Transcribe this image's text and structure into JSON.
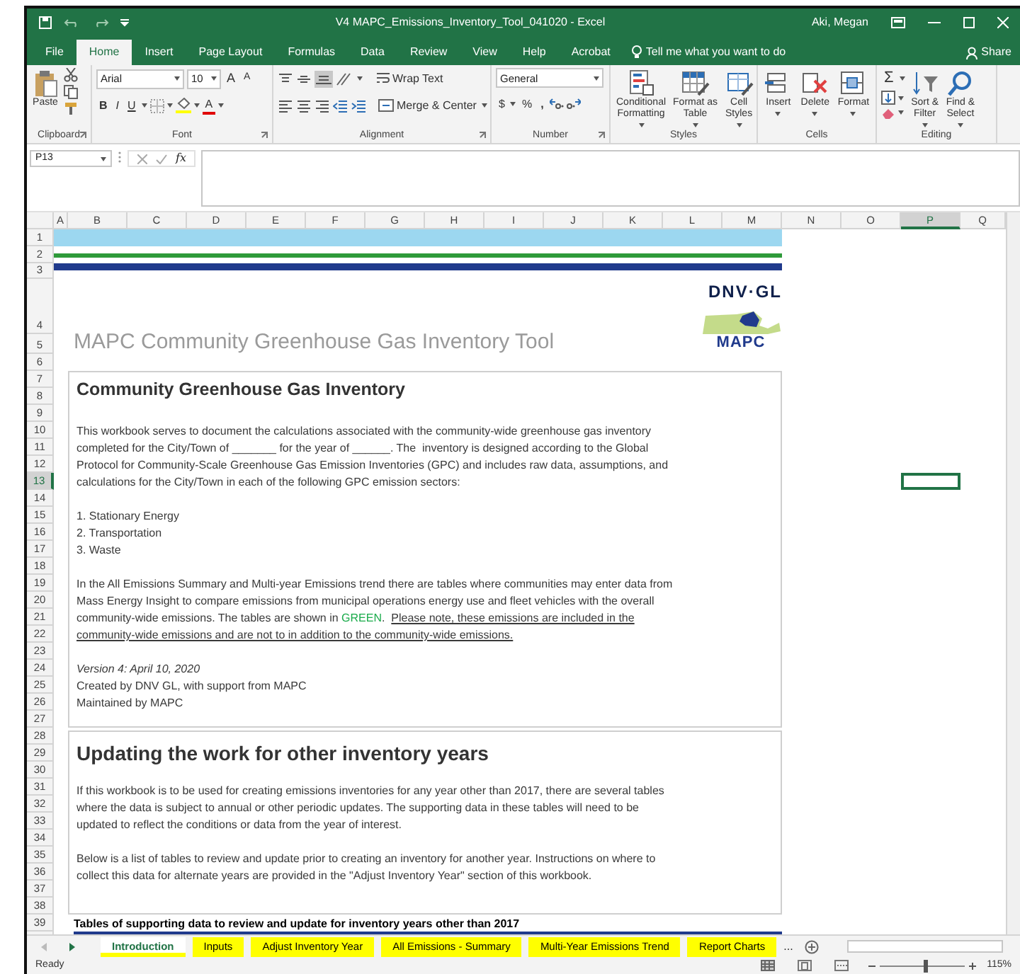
{
  "window": {
    "title": "V4 MAPC_Emissions_Inventory_Tool_041020  -  Excel",
    "user": "Aki, Megan"
  },
  "ribbon_tabs": [
    {
      "label": "File",
      "selected": false
    },
    {
      "label": "Home",
      "selected": true
    },
    {
      "label": "Insert",
      "selected": false
    },
    {
      "label": "Page Layout",
      "selected": false
    },
    {
      "label": "Formulas",
      "selected": false
    },
    {
      "label": "Data",
      "selected": false
    },
    {
      "label": "Review",
      "selected": false
    },
    {
      "label": "View",
      "selected": false
    },
    {
      "label": "Help",
      "selected": false
    },
    {
      "label": "Acrobat",
      "selected": false
    }
  ],
  "tell_me": "Tell me what you want to do",
  "share": "Share",
  "ribbon": {
    "clipboard": {
      "label": "Clipboard",
      "paste": "Paste"
    },
    "font": {
      "label": "Font",
      "font_name": "Arial",
      "font_size": "10",
      "grow": "A",
      "shrink": "A",
      "bold": "B",
      "italic": "I",
      "underline": "U",
      "font_color": "A"
    },
    "alignment": {
      "label": "Alignment",
      "wrap_text": "Wrap Text",
      "merge_center": "Merge & Center"
    },
    "number": {
      "label": "Number",
      "format": "General",
      "currency": "$",
      "percent": "%",
      "comma": ","
    },
    "styles": {
      "label": "Styles",
      "buttons": [
        {
          "lines": [
            "Conditional",
            "Formatting"
          ]
        },
        {
          "lines": [
            "Format as",
            "Table"
          ]
        },
        {
          "lines": [
            "Cell",
            "Styles"
          ]
        }
      ]
    },
    "cells": {
      "label": "Cells",
      "buttons": [
        {
          "lines": [
            "Insert"
          ]
        },
        {
          "lines": [
            "Delete"
          ]
        },
        {
          "lines": [
            "Format"
          ]
        }
      ]
    },
    "editing": {
      "label": "Editing",
      "autosum": "Σ",
      "buttons": [
        {
          "lines": [
            "Sort &",
            "Filter"
          ]
        },
        {
          "lines": [
            "Find &",
            "Select"
          ]
        }
      ]
    }
  },
  "formula_bar": {
    "name_box": "P13",
    "function_label": "fx"
  },
  "columns": [
    {
      "label": "A",
      "selected": false
    },
    {
      "label": "B",
      "selected": false
    },
    {
      "label": "C",
      "selected": false
    },
    {
      "label": "D",
      "selected": false
    },
    {
      "label": "E",
      "selected": false
    },
    {
      "label": "F",
      "selected": false
    },
    {
      "label": "G",
      "selected": false
    },
    {
      "label": "H",
      "selected": false
    },
    {
      "label": "I",
      "selected": false
    },
    {
      "label": "J",
      "selected": false
    },
    {
      "label": "K",
      "selected": false
    },
    {
      "label": "L",
      "selected": false
    },
    {
      "label": "M",
      "selected": false
    },
    {
      "label": "N",
      "selected": false
    },
    {
      "label": "O",
      "selected": false
    },
    {
      "label": "P",
      "selected": true
    },
    {
      "label": "Q",
      "selected": false
    }
  ],
  "rows": [
    {
      "label": "1",
      "selected": false
    },
    {
      "label": "2",
      "selected": false
    },
    {
      "label": "3",
      "selected": false
    },
    {
      "label": "4",
      "selected": false
    },
    {
      "label": "5",
      "selected": false
    },
    {
      "label": "6",
      "selected": false
    },
    {
      "label": "7",
      "selected": false
    },
    {
      "label": "8",
      "selected": false
    },
    {
      "label": "9",
      "selected": false
    },
    {
      "label": "10",
      "selected": false
    },
    {
      "label": "11",
      "selected": false
    },
    {
      "label": "12",
      "selected": false
    },
    {
      "label": "13",
      "selected": true
    },
    {
      "label": "14",
      "selected": false
    },
    {
      "label": "15",
      "selected": false
    },
    {
      "label": "16",
      "selected": false
    },
    {
      "label": "17",
      "selected": false
    },
    {
      "label": "18",
      "selected": false
    },
    {
      "label": "19",
      "selected": false
    },
    {
      "label": "20",
      "selected": false
    },
    {
      "label": "21",
      "selected": false
    },
    {
      "label": "22",
      "selected": false
    },
    {
      "label": "23",
      "selected": false
    },
    {
      "label": "24",
      "selected": false
    },
    {
      "label": "25",
      "selected": false
    },
    {
      "label": "26",
      "selected": false
    },
    {
      "label": "27",
      "selected": false
    },
    {
      "label": "28",
      "selected": false
    },
    {
      "label": "29",
      "selected": false
    },
    {
      "label": "30",
      "selected": false
    },
    {
      "label": "31",
      "selected": false
    },
    {
      "label": "32",
      "selected": false
    },
    {
      "label": "33",
      "selected": false
    },
    {
      "label": "34",
      "selected": false
    },
    {
      "label": "35",
      "selected": false
    },
    {
      "label": "36",
      "selected": false
    },
    {
      "label": "37",
      "selected": false
    },
    {
      "label": "38",
      "selected": false
    },
    {
      "label": "39",
      "selected": false
    }
  ],
  "sheet": {
    "logo": "DNV·GL",
    "mapc_logo": "MAPC",
    "title": "MAPC Community Greenhouse Gas Inventory Tool",
    "sections": [
      {
        "heading": "Community Greenhouse Gas Inventory",
        "paragraphs": [
          {
            "lines": [
              "This workbook serves to document the calculations associated with the community-wide greenhouse gas inventory",
              "completed for the City/Town of _______ for the year of ______. The  inventory is designed according to the Global",
              "Protocol for Community-Scale Greenhouse Gas Emission Inventories (GPC) and includes raw data, assumptions, and",
              "calculations for the City/Town in each of the following GPC emission sectors:"
            ]
          },
          {
            "lines": [
              "1. Stationary Energy",
              "2. Transportation",
              "3. Waste"
            ]
          },
          {
            "lines": [
              "In the All Emissions Summary and Multi-year Emissions trend there are tables where communities may enter data from",
              "Mass Energy Insight to compare emissions from municipal operations energy use and fleet vehicles with the overall",
              [
                {
                  "text": "community-wide emissions. The tables are shown in ",
                  "kind": "plain"
                },
                {
                  "text": "GREEN",
                  "kind": "green"
                },
                {
                  "text": ".  ",
                  "kind": "plain"
                },
                {
                  "text": "Please note, these emissions are included in the",
                  "kind": "underline"
                }
              ],
              [
                {
                  "text": "community-wide emissions and are not to in addition to the community-wide emissions.",
                  "kind": "underline"
                }
              ]
            ]
          },
          {
            "lines": [
              "*Version 4: April 10, 2020*",
              "Created by DNV GL, with support from MAPC",
              "Maintained by MAPC"
            ]
          }
        ]
      },
      {
        "heading": "Updating the work for other inventory years",
        "paragraphs": [
          {
            "lines": [
              "If this workbook is to be used for creating emissions inventories for any year other than 2017, there are several tables",
              "where the data is subject to annual or other periodic updates. The supporting data in these tables will need to be",
              "updated to reflect the conditions or data from the year of interest."
            ]
          },
          {
            "lines": [
              "Below is a list of tables to review and update prior to creating an inventory for another year. Instructions on where to",
              "collect this data for alternate years are provided in the \"Adjust Inventory Year\" section of this workbook."
            ]
          }
        ]
      }
    ],
    "tables_heading": "Tables of supporting data to review and update for inventory years other than 2017"
  },
  "sheet_tabs": [
    {
      "label": "Introduction",
      "selected": true,
      "color": "#ffff00"
    },
    {
      "label": "Inputs",
      "selected": false,
      "color": "#ffff00"
    },
    {
      "label": "Adjust Inventory Year",
      "selected": false,
      "color": "#ffff00"
    },
    {
      "label": "All Emissions - Summary",
      "selected": false,
      "color": "#ffff00"
    },
    {
      "label": "Multi-Year Emissions Trend",
      "selected": false,
      "color": "#ffff00"
    },
    {
      "label": "Report Charts",
      "selected": false,
      "color": "#ffff00"
    }
  ],
  "more_tabs": "...",
  "status_bar": {
    "status": "Ready",
    "zoom": "115%",
    "zoom_slider": {
      "level": 0.52
    }
  }
}
